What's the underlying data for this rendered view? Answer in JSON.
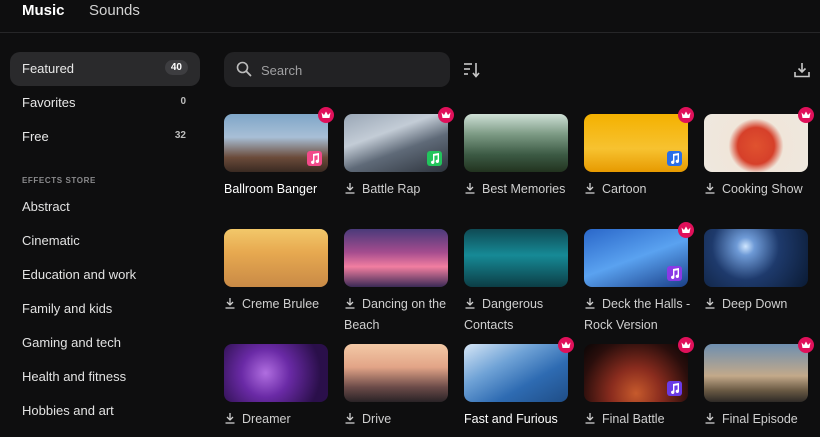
{
  "tabs": {
    "music": "Music",
    "sounds": "Sounds"
  },
  "sidebar": {
    "items": [
      {
        "label": "Featured",
        "count": "40"
      },
      {
        "label": "Favorites",
        "count": "0"
      },
      {
        "label": "Free",
        "count": "32"
      }
    ],
    "store_heading": "EFFECTS STORE",
    "categories": [
      "Abstract",
      "Cinematic",
      "Education and work",
      "Family and kids",
      "Gaming and tech",
      "Health and fitness",
      "Hobbies and art"
    ]
  },
  "search": {
    "placeholder": "Search"
  },
  "tracks": [
    {
      "title": "Ballroom Banger",
      "premium": true,
      "note_color": "#f24a8a",
      "installed": true
    },
    {
      "title": "Battle Rap",
      "premium": true,
      "note_color": "#22c45c",
      "installed": false
    },
    {
      "title": "Best Memories",
      "premium": false,
      "note_color": "",
      "installed": false
    },
    {
      "title": "Cartoon",
      "premium": true,
      "note_color": "#2a6ee8",
      "installed": false
    },
    {
      "title": "Cooking Show",
      "premium": true,
      "note_color": "",
      "installed": false
    },
    {
      "title": "Creme Brulee",
      "premium": false,
      "note_color": "",
      "installed": false
    },
    {
      "title": "Dancing on the Beach",
      "premium": false,
      "note_color": "",
      "installed": false
    },
    {
      "title": "Dangerous Contacts",
      "premium": false,
      "note_color": "",
      "installed": false
    },
    {
      "title": "Deck the Halls - Rock Version",
      "premium": true,
      "note_color": "#8a3ae6",
      "installed": false
    },
    {
      "title": "Deep Down",
      "premium": false,
      "note_color": "",
      "installed": false
    },
    {
      "title": "Dreamer",
      "premium": false,
      "note_color": "",
      "installed": false
    },
    {
      "title": "Drive",
      "premium": false,
      "note_color": "",
      "installed": false
    },
    {
      "title": "Fast and Furious",
      "premium": true,
      "note_color": "",
      "installed": true
    },
    {
      "title": "Final Battle",
      "premium": true,
      "note_color": "#6a3ae6",
      "installed": false
    },
    {
      "title": "Final Episode",
      "premium": true,
      "note_color": "",
      "installed": false
    }
  ],
  "colors": {
    "accent_premium": "#e0105a",
    "background": "#0e0e0f",
    "panel": "#222224"
  }
}
